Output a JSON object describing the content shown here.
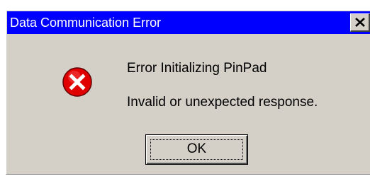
{
  "window": {
    "title": "Data Communication Error",
    "close_icon": "close-icon"
  },
  "message": {
    "icon": "error-icon",
    "line1": "Error Initializing PinPad",
    "line2": "Invalid or unexpected response."
  },
  "buttons": {
    "ok_label": "OK"
  },
  "colors": {
    "titlebar": "#0000ff",
    "dialog_face": "#d4d0c8",
    "error_red": "#e00000"
  }
}
